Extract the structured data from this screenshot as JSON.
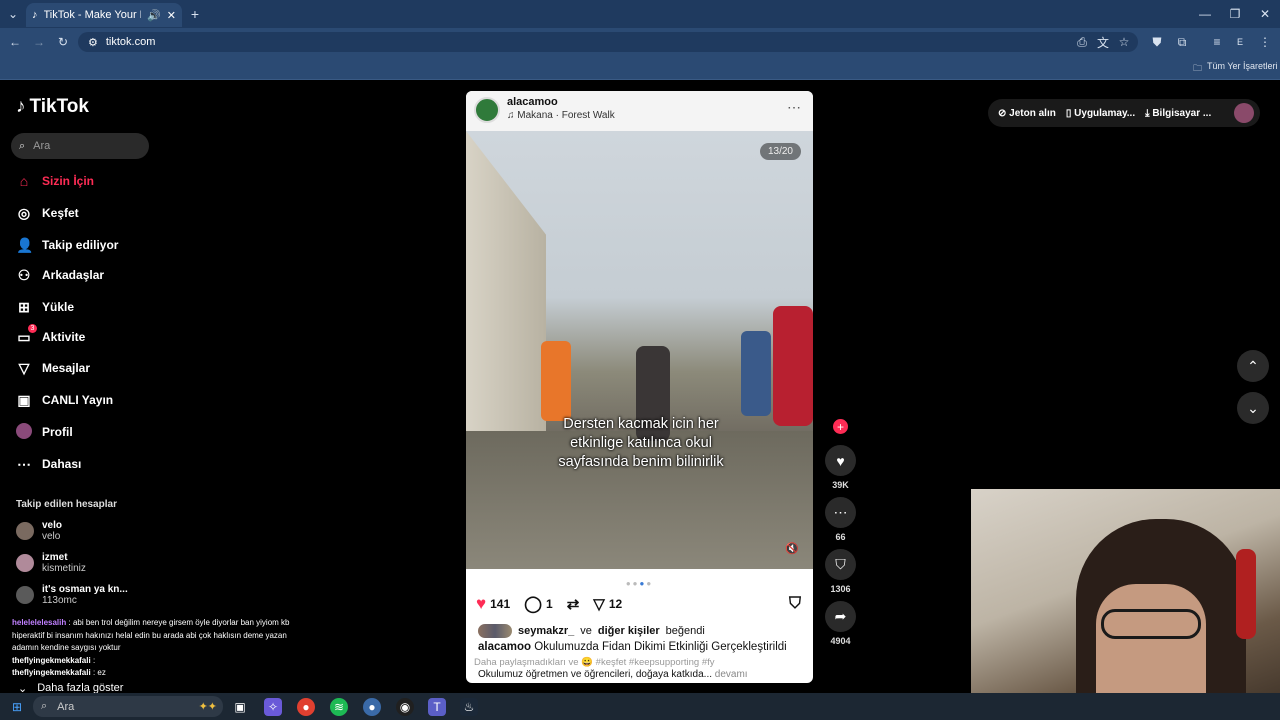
{
  "browser": {
    "tab_title": "TikTok - Make Your Day",
    "url": "tiktok.com",
    "bookmarks_label": "Tüm Yer İşaretleri"
  },
  "sidebar": {
    "logo": "TikTok",
    "search_placeholder": "Ara",
    "items": [
      {
        "label": "Sizin İçin",
        "icon": "home-icon"
      },
      {
        "label": "Keşfet",
        "icon": "compass-icon"
      },
      {
        "label": "Takip ediliyor",
        "icon": "following-icon"
      },
      {
        "label": "Arkadaşlar",
        "icon": "friends-icon"
      },
      {
        "label": "Yükle",
        "icon": "upload-icon"
      },
      {
        "label": "Aktivite",
        "icon": "activity-icon",
        "badge": "3"
      },
      {
        "label": "Mesajlar",
        "icon": "messages-icon"
      },
      {
        "label": "CANLI Yayın",
        "icon": "live-icon"
      },
      {
        "label": "Profil",
        "icon": "profile-icon"
      },
      {
        "label": "Dahası",
        "icon": "more-icon"
      }
    ],
    "following_header": "Takip edilen hesaplar",
    "following": [
      {
        "name": "velo",
        "sub": "velo"
      },
      {
        "name": "izmet",
        "sub": "kismetiniz"
      },
      {
        "name": "it's osman ya kn...",
        "sub": "113omc"
      }
    ],
    "show_more": "Daha fazla göster"
  },
  "chat": [
    {
      "user": "helelelelesalih",
      "text": ": abi ben trol değilim nereye girsem öyle diyorlar ban yiyiom kb hiperaktif bi insanım hakınızı helal edin bu arada abi çok haklısın deme yazan adamın kendine saygısı yoktur"
    },
    {
      "user": "theflyingekmekkafali",
      "text": ":"
    },
    {
      "user": "theflyingekmekkafali",
      "text": ": ez"
    }
  ],
  "post": {
    "username": "alacamoo",
    "music": "♫ Makana · Forest Walk",
    "counter": "13/20",
    "caption": "Dersten kacmak icin her etkinlige katılınca okul sayfasında benim bilinirlik",
    "likes": "141",
    "comments": "1",
    "shares": "12",
    "liked_by_user": "seymakzr_",
    "liked_by_middle": "ve",
    "liked_by_others": "diğer kişiler",
    "liked_by_suffix": "beğendi",
    "description_user": "alacamoo",
    "description": "Okulumuzda Fidan Dikimi Etkinliği Gerçekleştirildi",
    "hashtags": "Daha paylaşmadıkları ve 😀 #keşfet #keepsupporting #fy",
    "description_more": "Okulumuz öğretmen ve öğrencileri, doğaya katkıda...",
    "more_label": "devamı"
  },
  "rail": {
    "likes": "39K",
    "comments": "66",
    "saves": "1306",
    "shares": "4904"
  },
  "topbar": {
    "coins": "Jeton alın",
    "app": "Uygulamay...",
    "desktop": "Bilgisayar ..."
  },
  "taskbar": {
    "search": "Ara"
  }
}
